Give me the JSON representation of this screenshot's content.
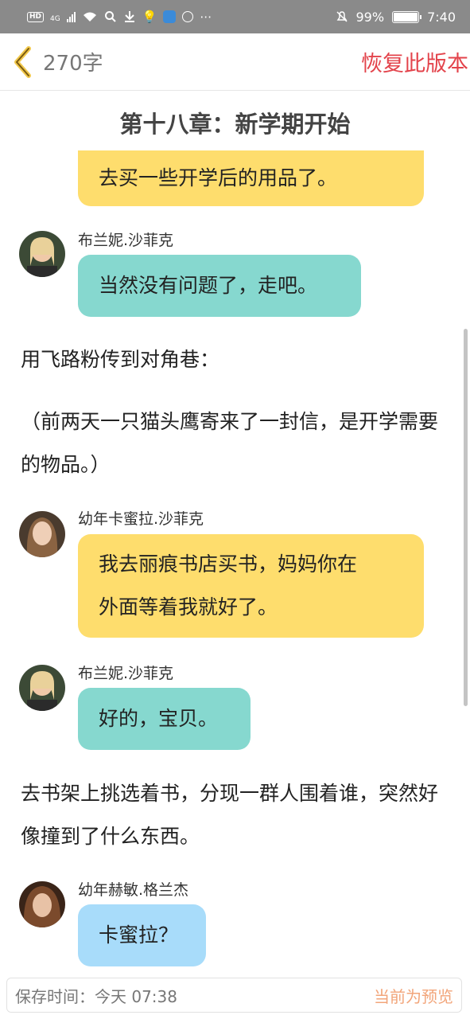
{
  "status_bar": {
    "network_badge": "HD",
    "network_type": "4G",
    "battery": "99%",
    "battery_level": 0.99,
    "time": "7:40"
  },
  "header": {
    "word_count": "270字",
    "restore_label": "恢复此版本"
  },
  "content": {
    "chapter_title": "第十八章：新学期开始",
    "bubble_partial": "去买一些开学后的用品了。",
    "msg1": {
      "speaker": "布兰妮.沙菲克",
      "text": "当然没有问题了，走吧。"
    },
    "narration1": "用飞路粉传到对角巷：",
    "narration2": "（前两天一只猫头鹰寄来了一封信，是开学需要的物品。）",
    "msg2": {
      "speaker": "幼年卡蜜拉.沙菲克",
      "line1": "我去丽痕书店买书，妈妈你在",
      "line2": "外面等着我就好了。"
    },
    "msg3": {
      "speaker": "布兰妮.沙菲克",
      "text": "好的，宝贝。"
    },
    "narration3": "去书架上挑选着书，分现一群人围着谁，突然好像撞到了什么东西。",
    "msg4": {
      "speaker": "幼年赫敏.格兰杰",
      "text": "卡蜜拉？"
    }
  },
  "footer": {
    "save_time": "保存时间：今天 07:38",
    "preview_status": "当前为预览"
  },
  "colors": {
    "accent": "#e3434b",
    "bubble_yellow": "#fedd6d",
    "bubble_teal": "#86d8cf",
    "bubble_blue": "#a8dcfa",
    "preview": "#f2a57a"
  }
}
